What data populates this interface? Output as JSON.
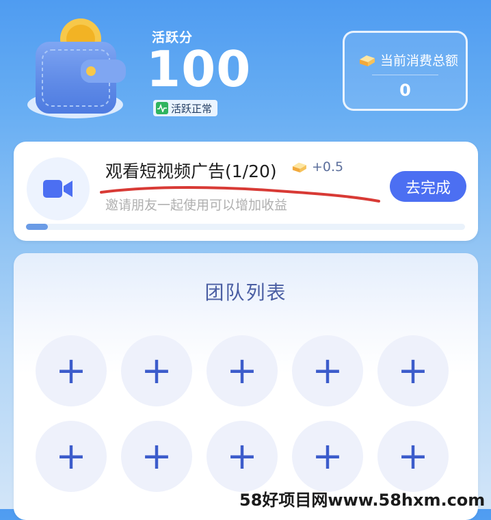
{
  "header": {
    "score_label": "活跃分",
    "score_value": "100",
    "status_text": "活跃正常",
    "spend_label": "当前消费总额",
    "spend_value": "0"
  },
  "task": {
    "title": "观看短视频广告(1/20)",
    "reward": "+0.5",
    "subtitle": "邀请朋友一起使用可以增加收益",
    "button_label": "去完成",
    "progress_fraction": 0.05,
    "icon": "video-camera-icon"
  },
  "team": {
    "title": "团队列表",
    "slots": [
      "+",
      "+",
      "+",
      "+",
      "+",
      "+",
      "+",
      "+",
      "+",
      "+"
    ]
  },
  "watermark": "58好项目网www.58hxm.com",
  "colors": {
    "accent": "#4c6ff2",
    "background_top": "#4f9cf1",
    "status_green": "#2fb45f",
    "annotation_red": "#d83a35"
  }
}
